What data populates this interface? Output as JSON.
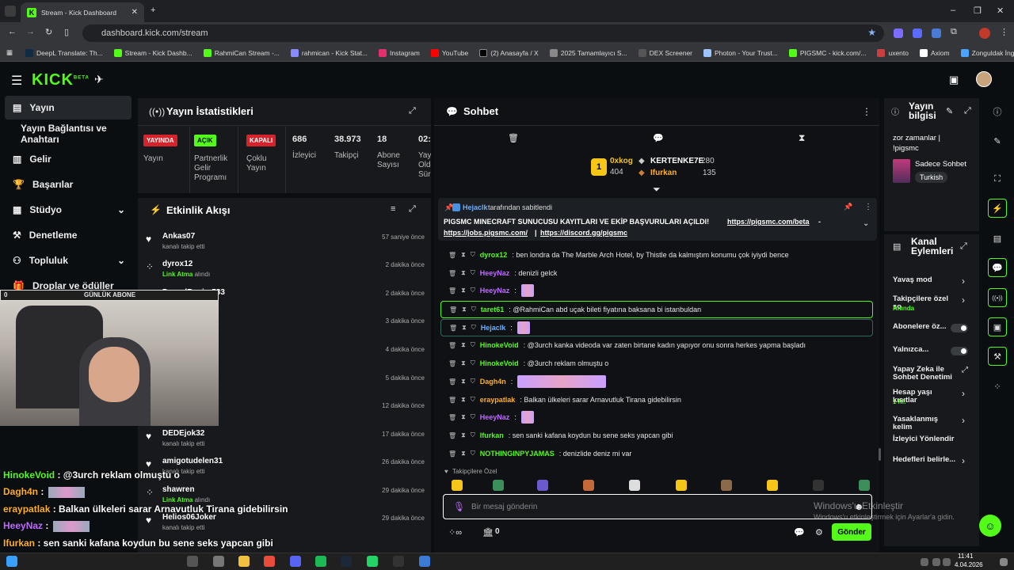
{
  "browser": {
    "tab_title": "Stream - Kick Dashboard",
    "url": "dashboard.kick.com/stream",
    "bookmarks": [
      "DeepL Translate: Th...",
      "Stream - Kick Dashb...",
      "RahmiCan Stream -...",
      "rahmican - Kick Stat...",
      "Instagram",
      "YouTube",
      "(2) Anasayfa / X",
      "2025 Tamamlayıcı S...",
      "DEX Screener",
      "Photon - Your Trust...",
      "PIGSMC - kick.com/...",
      "uxento",
      "Axiom",
      "Zonguldak İngilizce..."
    ]
  },
  "header": {
    "logo": "KICK",
    "logo_sup": "BETA"
  },
  "sidebar": {
    "items": [
      {
        "label": "Yayın",
        "icon": "broadcast-icon"
      },
      {
        "label": "Yayın Bağlantısı ve Anahtarı"
      },
      {
        "label": "Gelir",
        "icon": "revenue-icon"
      },
      {
        "label": "Başarılar",
        "icon": "trophy-icon"
      },
      {
        "label": "Stüdyo",
        "icon": "studio-icon"
      },
      {
        "label": "Denetleme",
        "icon": "moderation-icon"
      },
      {
        "label": "Topluluk",
        "icon": "community-icon"
      },
      {
        "label": "Droplar ve ödüller",
        "icon": "drops-icon"
      }
    ]
  },
  "stats": {
    "title": "Yayın İstatistikleri",
    "badges": {
      "live": "YAYINDA",
      "on": "AÇIK",
      "off": "KAPALI"
    },
    "labels": {
      "live": "Yayın",
      "partner": "Partnerlik Gelir Programı",
      "multi": "Çoklu Yayın",
      "viewers": "İzleyici",
      "followers": "Takipçi",
      "subs": "Abone Sayısı",
      "time": "Yay Old Sür"
    },
    "values": {
      "viewers": "686",
      "followers": "38.973",
      "subs": "18",
      "time": "02:"
    }
  },
  "activity": {
    "title": "Etkinlik Akışı",
    "items": [
      {
        "name": "Ankas07",
        "sub": "kanalı takip etti",
        "time": "57 saniye önce"
      },
      {
        "name": "dyrox12",
        "sub_hl": "Link Atma",
        "sub": "alındı",
        "time": "2 dakika önce"
      },
      {
        "name": "DorsalRapier583",
        "sub": "",
        "time": "2 dakika önce"
      },
      {
        "name": "",
        "sub": "",
        "time": "3 dakika önce"
      },
      {
        "name": "",
        "sub": "",
        "time": "4 dakika önce"
      },
      {
        "name": "",
        "sub": "",
        "time": "5 dakika önce"
      },
      {
        "name": "",
        "sub": "",
        "time": "12 dakika önce"
      },
      {
        "name": "DEDEjok32",
        "sub": "kanalı takip etti",
        "time": "17 dakika önce"
      },
      {
        "name": "amigotudelen31",
        "sub": "kanalı takip etti",
        "time": "26 dakika önce"
      },
      {
        "name": "shawren",
        "sub_hl": "Link Atma",
        "sub": "alındı",
        "time": "29 dakika önce"
      },
      {
        "name": "Helios06Joker",
        "sub": "kanalı takip etti",
        "time": "29 dakika önce"
      }
    ]
  },
  "webcam": {
    "goal_count": "0",
    "goal_label": "GÜNLÜK ABONE",
    "overlay_chat": [
      {
        "user": "HinokeVoid",
        "text": " : @3urch reklam olmuştu o",
        "color": "#53fc18"
      },
      {
        "user": "Dagh4n",
        "text": " :",
        "color": "#ffb020"
      },
      {
        "user": "eraypatlak",
        "text": " : Balkan ülkeleri sarar Arnavutluk Tirana gidebilirsin",
        "color": "#ffb020"
      },
      {
        "user": "HeeyNaz",
        "text": " :",
        "color": "#c06bff"
      },
      {
        "user": "Ifurkan",
        "text": " : sen sanki kafana koydun bu sene seks yapcan gibi",
        "color": "#ffb020"
      },
      {
        "user": "NOTHINGINPYJAMAS",
        "text": " : denizlide deniz mi var",
        "color": "#53fc18"
      }
    ]
  },
  "chat": {
    "title": "Sohbet",
    "leaderboard": [
      {
        "name": "0xkog",
        "value": "404"
      },
      {
        "name": "KERTENKE7E",
        "value": "280"
      },
      {
        "name": "Ifurkan",
        "value": "135"
      }
    ],
    "pinned": {
      "by_user": "Hejaclk",
      "by_text": "tarafından sabitlendi",
      "text": "PIGSMC MINECRAFT SUNUCUSU KAYITLARI VE EKİP BAŞVURULARI AÇILDI!",
      "link1": "https://pigsmc.com/beta",
      "link2": "https://jobs.pigsmc.com/",
      "link3": "https://discord.gg/pigsmc"
    },
    "messages": [
      {
        "user": "dyrox12",
        "text": ": ben londra da The Marble Arch Hotel, by Thistle da kalmıştım konumu çok iyiydi bence",
        "color": "#53fc18"
      },
      {
        "user": "HeeyNaz",
        "text": ": denizli gelck",
        "color": "#c06bff"
      },
      {
        "user": "HeeyNaz",
        "text": ":",
        "color": "#c06bff"
      },
      {
        "user": "taret61",
        "text": ": @RahmiCan abd uçak bileti fiyatına baksana bi istanbuldan",
        "color": "#53fc18"
      },
      {
        "user": "Hejaclk",
        "text": ":",
        "color": "#6ab0ff"
      },
      {
        "user": "HinokeVoid",
        "text": ": @3urch kanka videoda var zaten birtane kadın yapıyor onu sonra herkes yapma başladı",
        "color": "#53fc18"
      },
      {
        "user": "HinokeVoid",
        "text": ": @3urch reklam olmuştu o",
        "color": "#53fc18"
      },
      {
        "user": "Dagh4n",
        "text": ":",
        "color": "#ffb020"
      },
      {
        "user": "eraypatlak",
        "text": ": Balkan ülkeleri sarar Arnavutluk Tirana gidebilirsin",
        "color": "#ffb020"
      },
      {
        "user": "HeeyNaz",
        "text": ":",
        "color": "#c06bff"
      },
      {
        "user": "Ifurkan",
        "text": ": sen sanki kafana koydun bu sene seks yapcan gibi",
        "color": "#53fc18"
      },
      {
        "user": "NOTHINGINPYJAMAS",
        "text": ": denizlide deniz mi var",
        "color": "#53fc18"
      }
    ],
    "emote_bar_label": "Takipçilere Özel",
    "input_placeholder": "Bir mesaj gönderin",
    "points": "0",
    "send_label": "Gönder"
  },
  "stream_info": {
    "title": "Yayın bilgisi",
    "stream_title": "zor zamanlar | !pigsmc",
    "category": "Sadece Sohbet",
    "language": "Turkish"
  },
  "channel_actions": {
    "title": "Kanal Eylemleri",
    "items": [
      {
        "label": "Yavaş mod"
      },
      {
        "label": "Takipçilere özel so",
        "sub": "Anında"
      },
      {
        "label": "Abonelere öz..."
      },
      {
        "label": "Yalnızca..."
      },
      {
        "label": "Yapay Zeka ile Sohbet Denetimi"
      },
      {
        "label": "Hesap yaşı kısıtlar",
        "sub": "1 hf."
      },
      {
        "label": "Yasaklanmış kelim"
      },
      {
        "label": "İzleyici Yönlendir"
      },
      {
        "label": "Hedefleri belirle..."
      }
    ]
  },
  "windows": {
    "watermark_title": "Windows'u Etkinleştir",
    "watermark_sub": "Windows'u etkinleştirmek için Ayarlar'a gidin.",
    "time": "11:41",
    "date": "4.04.2026"
  }
}
